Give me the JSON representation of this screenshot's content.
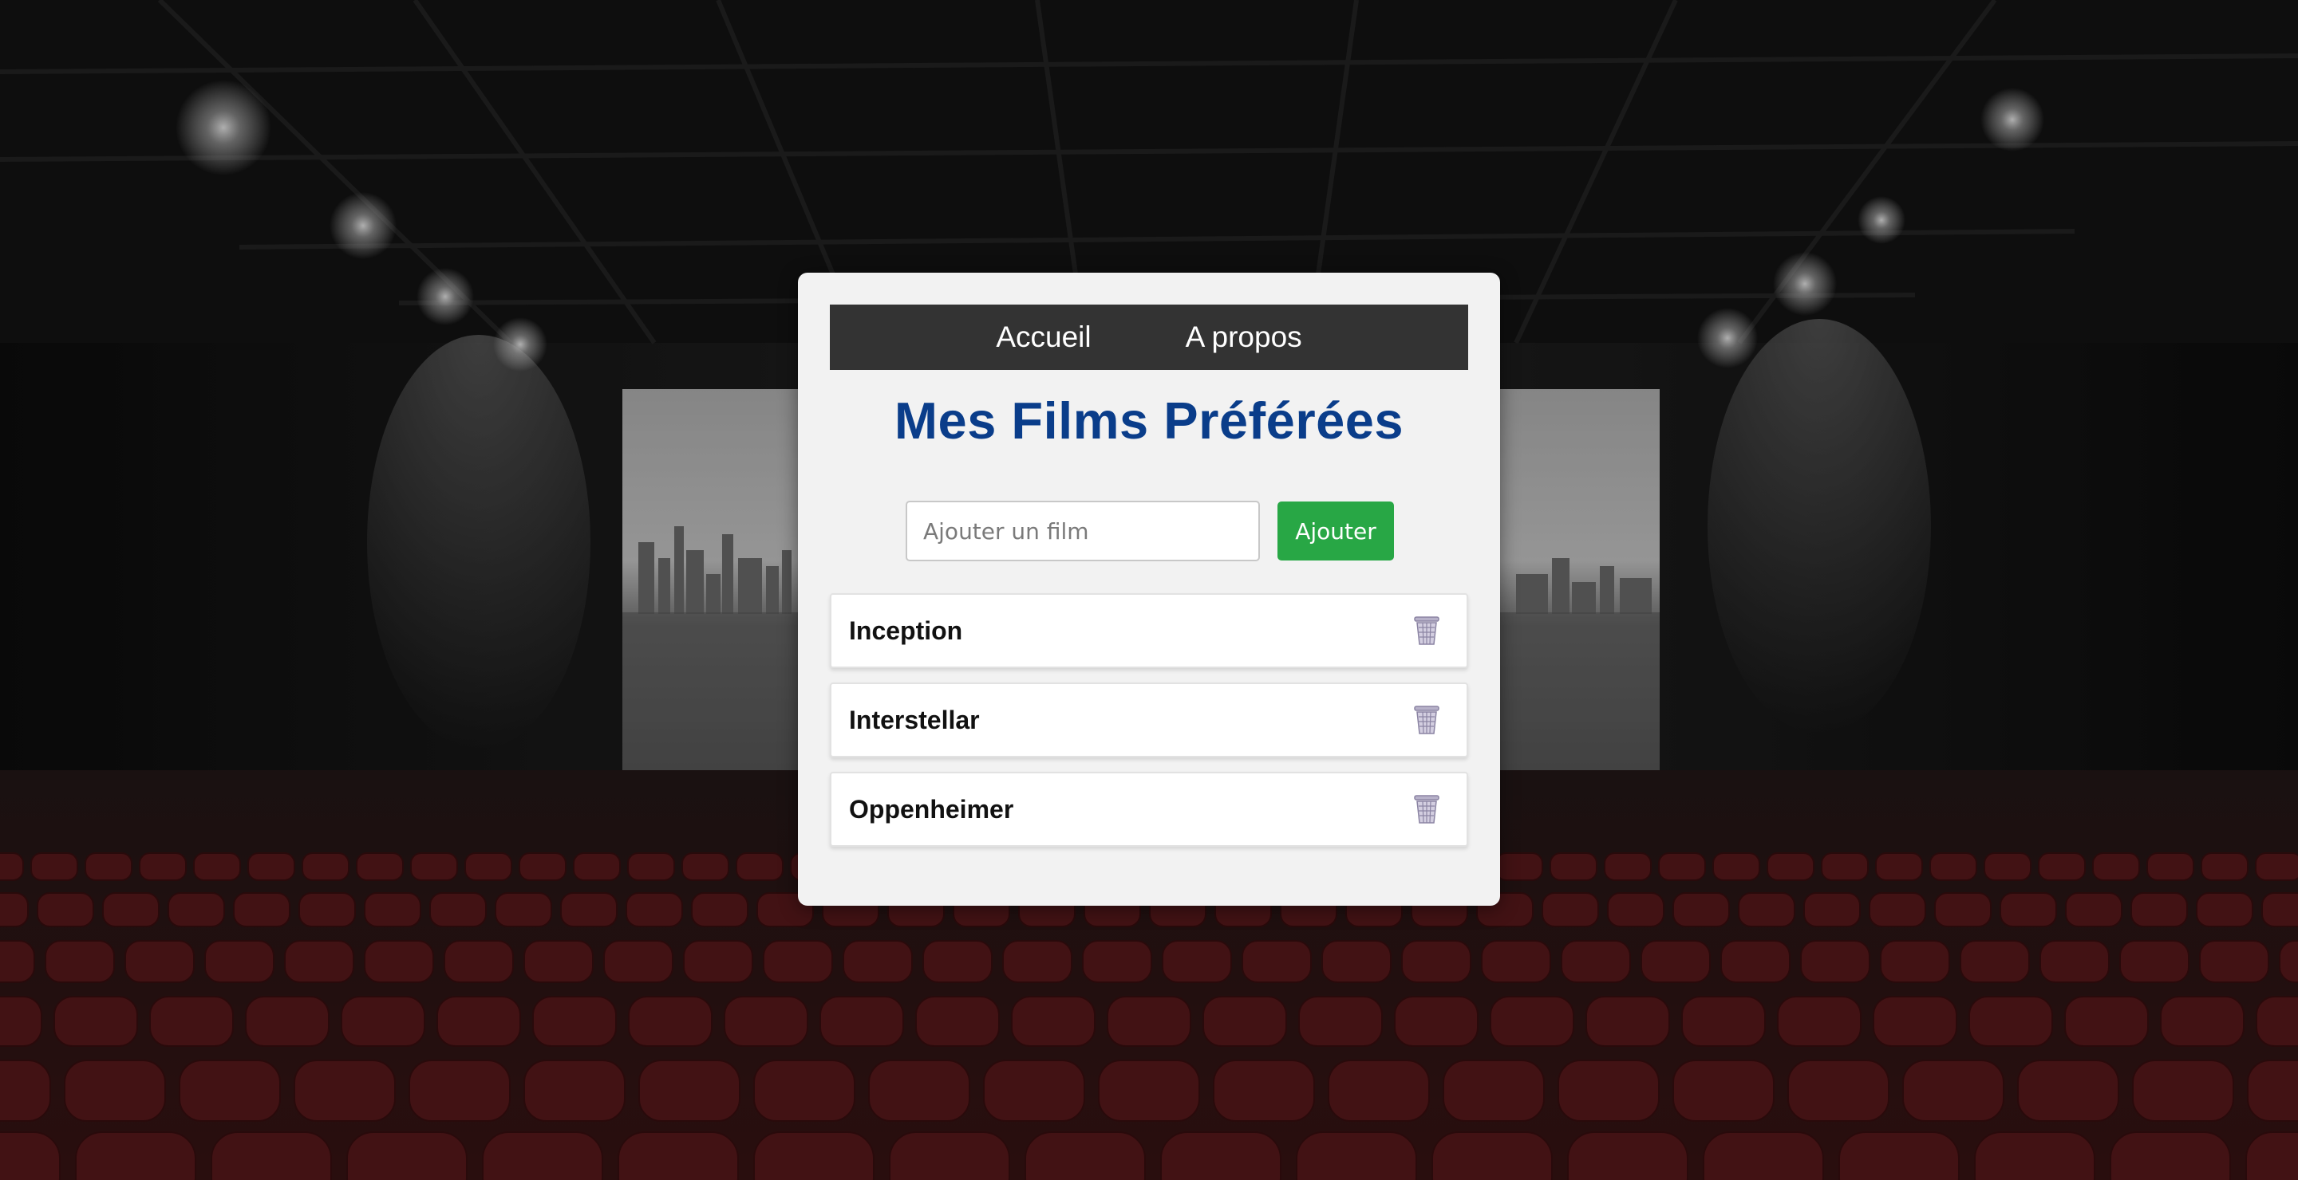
{
  "colors": {
    "nav_background": "#333333",
    "title": "#0a3d8a",
    "add_button": "#28a745",
    "card_background": "#f2f2f2",
    "seat_red": "#5c1a1c"
  },
  "nav": {
    "items": [
      {
        "label": "Accueil"
      },
      {
        "label": "A propos"
      }
    ]
  },
  "page": {
    "title": "Mes Films Préférées"
  },
  "form": {
    "placeholder": "Ajouter un film",
    "value": "",
    "add_label": "Ajouter"
  },
  "films": [
    {
      "title": "Inception",
      "delete_icon": "trash-icon"
    },
    {
      "title": "Interstellar",
      "delete_icon": "trash-icon"
    },
    {
      "title": "Oppenheimer",
      "delete_icon": "trash-icon"
    }
  ],
  "background": {
    "scene": "cinema-theater-photo"
  }
}
